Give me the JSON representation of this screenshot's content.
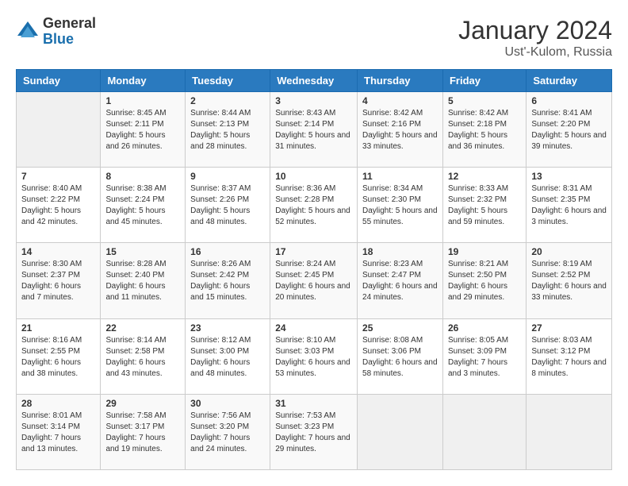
{
  "logo": {
    "general": "General",
    "blue": "Blue"
  },
  "title": "January 2024",
  "location": "Ust'-Kulom, Russia",
  "weekdays": [
    "Sunday",
    "Monday",
    "Tuesday",
    "Wednesday",
    "Thursday",
    "Friday",
    "Saturday"
  ],
  "weeks": [
    [
      {
        "day": null,
        "sunrise": null,
        "sunset": null,
        "daylight": null
      },
      {
        "day": "1",
        "sunrise": "8:45 AM",
        "sunset": "2:11 PM",
        "daylight": "5 hours and 26 minutes."
      },
      {
        "day": "2",
        "sunrise": "8:44 AM",
        "sunset": "2:13 PM",
        "daylight": "5 hours and 28 minutes."
      },
      {
        "day": "3",
        "sunrise": "8:43 AM",
        "sunset": "2:14 PM",
        "daylight": "5 hours and 31 minutes."
      },
      {
        "day": "4",
        "sunrise": "8:42 AM",
        "sunset": "2:16 PM",
        "daylight": "5 hours and 33 minutes."
      },
      {
        "day": "5",
        "sunrise": "8:42 AM",
        "sunset": "2:18 PM",
        "daylight": "5 hours and 36 minutes."
      },
      {
        "day": "6",
        "sunrise": "8:41 AM",
        "sunset": "2:20 PM",
        "daylight": "5 hours and 39 minutes."
      }
    ],
    [
      {
        "day": "7",
        "sunrise": "8:40 AM",
        "sunset": "2:22 PM",
        "daylight": "5 hours and 42 minutes."
      },
      {
        "day": "8",
        "sunrise": "8:38 AM",
        "sunset": "2:24 PM",
        "daylight": "5 hours and 45 minutes."
      },
      {
        "day": "9",
        "sunrise": "8:37 AM",
        "sunset": "2:26 PM",
        "daylight": "5 hours and 48 minutes."
      },
      {
        "day": "10",
        "sunrise": "8:36 AM",
        "sunset": "2:28 PM",
        "daylight": "5 hours and 52 minutes."
      },
      {
        "day": "11",
        "sunrise": "8:34 AM",
        "sunset": "2:30 PM",
        "daylight": "5 hours and 55 minutes."
      },
      {
        "day": "12",
        "sunrise": "8:33 AM",
        "sunset": "2:32 PM",
        "daylight": "5 hours and 59 minutes."
      },
      {
        "day": "13",
        "sunrise": "8:31 AM",
        "sunset": "2:35 PM",
        "daylight": "6 hours and 3 minutes."
      }
    ],
    [
      {
        "day": "14",
        "sunrise": "8:30 AM",
        "sunset": "2:37 PM",
        "daylight": "6 hours and 7 minutes."
      },
      {
        "day": "15",
        "sunrise": "8:28 AM",
        "sunset": "2:40 PM",
        "daylight": "6 hours and 11 minutes."
      },
      {
        "day": "16",
        "sunrise": "8:26 AM",
        "sunset": "2:42 PM",
        "daylight": "6 hours and 15 minutes."
      },
      {
        "day": "17",
        "sunrise": "8:24 AM",
        "sunset": "2:45 PM",
        "daylight": "6 hours and 20 minutes."
      },
      {
        "day": "18",
        "sunrise": "8:23 AM",
        "sunset": "2:47 PM",
        "daylight": "6 hours and 24 minutes."
      },
      {
        "day": "19",
        "sunrise": "8:21 AM",
        "sunset": "2:50 PM",
        "daylight": "6 hours and 29 minutes."
      },
      {
        "day": "20",
        "sunrise": "8:19 AM",
        "sunset": "2:52 PM",
        "daylight": "6 hours and 33 minutes."
      }
    ],
    [
      {
        "day": "21",
        "sunrise": "8:16 AM",
        "sunset": "2:55 PM",
        "daylight": "6 hours and 38 minutes."
      },
      {
        "day": "22",
        "sunrise": "8:14 AM",
        "sunset": "2:58 PM",
        "daylight": "6 hours and 43 minutes."
      },
      {
        "day": "23",
        "sunrise": "8:12 AM",
        "sunset": "3:00 PM",
        "daylight": "6 hours and 48 minutes."
      },
      {
        "day": "24",
        "sunrise": "8:10 AM",
        "sunset": "3:03 PM",
        "daylight": "6 hours and 53 minutes."
      },
      {
        "day": "25",
        "sunrise": "8:08 AM",
        "sunset": "3:06 PM",
        "daylight": "6 hours and 58 minutes."
      },
      {
        "day": "26",
        "sunrise": "8:05 AM",
        "sunset": "3:09 PM",
        "daylight": "7 hours and 3 minutes."
      },
      {
        "day": "27",
        "sunrise": "8:03 AM",
        "sunset": "3:12 PM",
        "daylight": "7 hours and 8 minutes."
      }
    ],
    [
      {
        "day": "28",
        "sunrise": "8:01 AM",
        "sunset": "3:14 PM",
        "daylight": "7 hours and 13 minutes."
      },
      {
        "day": "29",
        "sunrise": "7:58 AM",
        "sunset": "3:17 PM",
        "daylight": "7 hours and 19 minutes."
      },
      {
        "day": "30",
        "sunrise": "7:56 AM",
        "sunset": "3:20 PM",
        "daylight": "7 hours and 24 minutes."
      },
      {
        "day": "31",
        "sunrise": "7:53 AM",
        "sunset": "3:23 PM",
        "daylight": "7 hours and 29 minutes."
      },
      {
        "day": null,
        "sunrise": null,
        "sunset": null,
        "daylight": null
      },
      {
        "day": null,
        "sunrise": null,
        "sunset": null,
        "daylight": null
      },
      {
        "day": null,
        "sunrise": null,
        "sunset": null,
        "daylight": null
      }
    ]
  ]
}
